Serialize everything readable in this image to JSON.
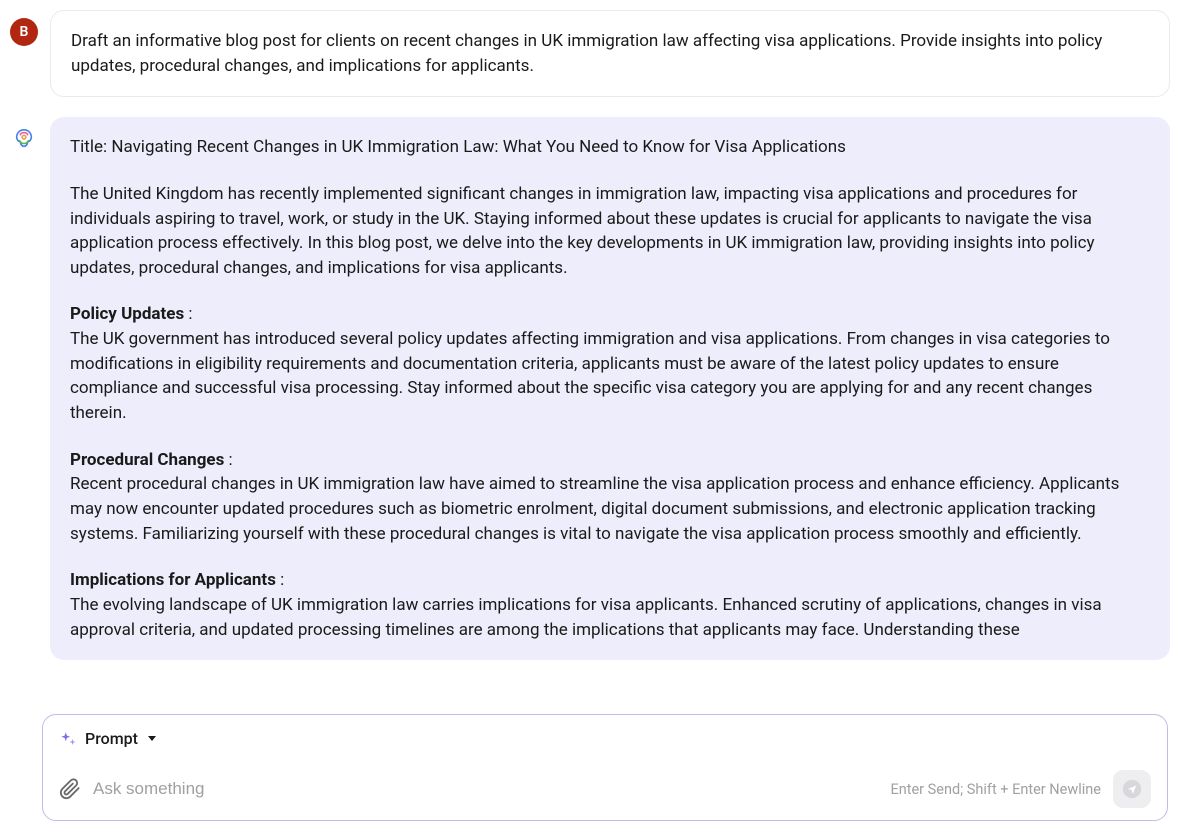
{
  "user": {
    "avatar_letter": "B",
    "message": "Draft an informative blog post for clients on recent changes in UK immigration law affecting visa applications. Provide insights into policy updates, procedural changes, and implications for applicants."
  },
  "ai": {
    "title": "Title: Navigating Recent Changes in UK Immigration Law: What You Need to Know for Visa Applications",
    "intro": "The United Kingdom has recently implemented significant changes in immigration law, impacting visa applications and procedures for individuals aspiring to travel, work, or study in the UK. Staying informed about these updates is crucial for applicants to navigate the visa application process effectively. In this blog post, we delve into the key developments in UK immigration law, providing insights into policy updates, procedural changes, and implications for visa applicants.",
    "section1_heading": "Policy Updates",
    "section1_body": "The UK government has introduced several policy updates affecting immigration and visa applications. From changes in visa categories to modifications in eligibility requirements and documentation criteria, applicants must be aware of the latest policy updates to ensure compliance and successful visa processing. Stay informed about the specific visa category you are applying for and any recent changes therein.",
    "section2_heading": "Procedural Changes",
    "section2_body": "Recent procedural changes in UK immigration law have aimed to streamline the visa application process and enhance efficiency. Applicants may now encounter updated procedures such as biometric enrolment, digital document submissions, and electronic application tracking systems. Familiarizing yourself with these procedural changes is vital to navigate the visa application process smoothly and efficiently.",
    "section3_heading": "Implications for Applicants",
    "section3_body": "The evolving landscape of UK immigration law carries implications for visa applicants. Enhanced scrutiny of applications, changes in visa approval criteria, and updated processing timelines are among the implications that applicants may face. Understanding these"
  },
  "input": {
    "prompt_label": "Prompt",
    "placeholder": "Ask something",
    "hint": "Enter Send; Shift + Enter Newline"
  }
}
